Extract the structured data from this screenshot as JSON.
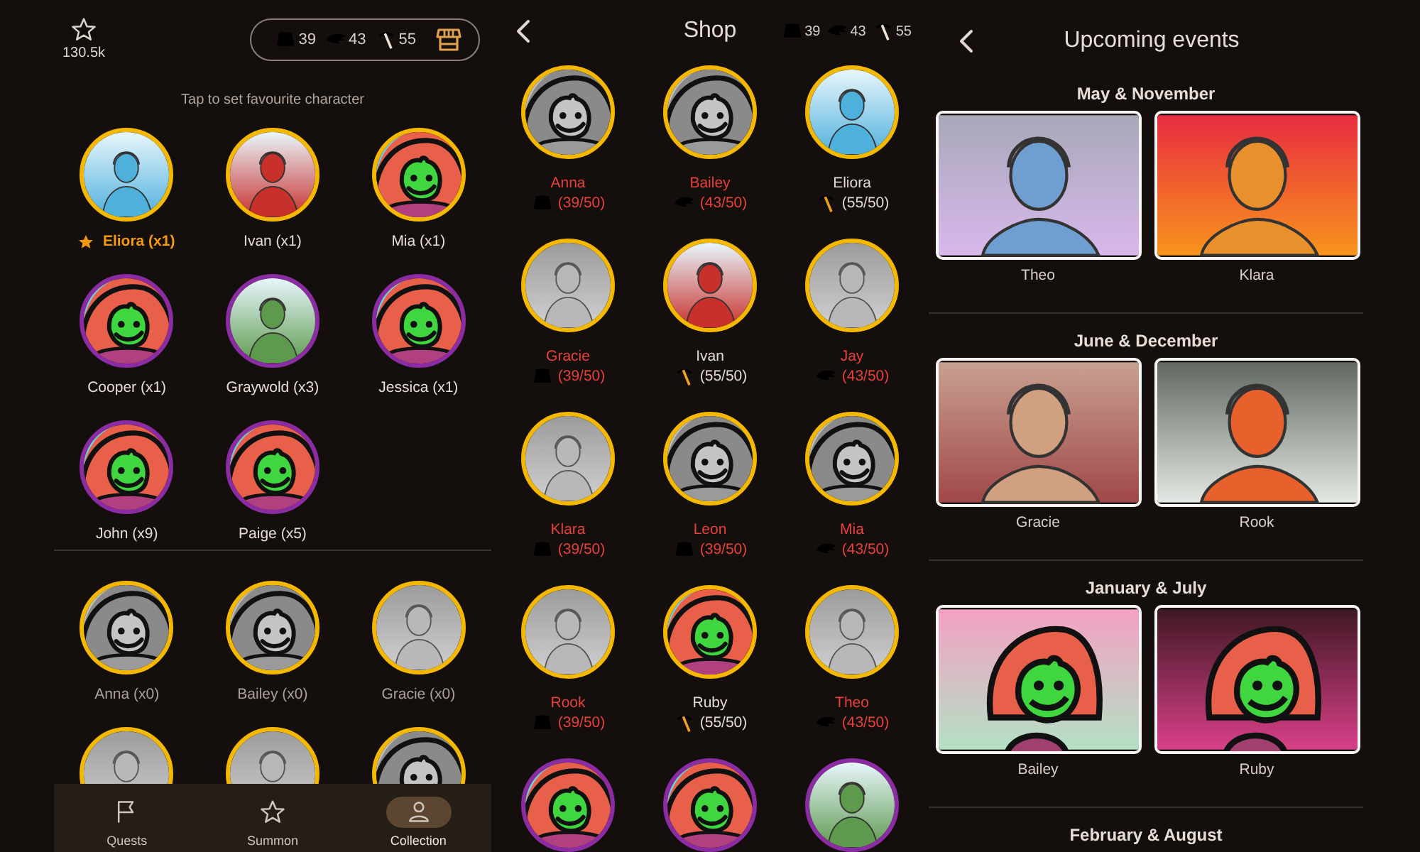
{
  "collection": {
    "stars": "130.5k",
    "currencies": [
      {
        "kind": "ticket",
        "amount": "39"
      },
      {
        "kind": "wing",
        "amount": "43"
      },
      {
        "kind": "pickaxe",
        "amount": "55"
      }
    ],
    "hint": "Tap to set favourite character",
    "owned": [
      {
        "label": "Eliora (x1)",
        "favourite": true,
        "color": "#f5b800",
        "avatar": {
          "kind": "portrait",
          "color": "#4fb0dc",
          "locked": false
        }
      },
      {
        "label": "Ivan (x1)",
        "favourite": false,
        "color": "#f5b800",
        "avatar": {
          "kind": "portrait",
          "color": "#c8302c",
          "locked": false
        }
      },
      {
        "label": "Mia (x1)",
        "favourite": false,
        "color": "#f5b800",
        "avatar": {
          "kind": "blob",
          "color": "#e8604a",
          "locked": false
        }
      },
      {
        "label": "Cooper (x1)",
        "favourite": false,
        "color": "#8c2ca4",
        "avatar": {
          "kind": "blob",
          "color": "#e8604a",
          "locked": false
        }
      },
      {
        "label": "Graywold (x3)",
        "favourite": false,
        "color": "#8c2ca4",
        "avatar": {
          "kind": "portrait",
          "color": "#5e9a4e",
          "locked": false
        }
      },
      {
        "label": "Jessica (x1)",
        "favourite": false,
        "color": "#8c2ca4",
        "avatar": {
          "kind": "blob",
          "color": "#e8604a",
          "locked": false
        }
      },
      {
        "label": "John (x9)",
        "favourite": false,
        "color": "#8c2ca4",
        "avatar": {
          "kind": "blob",
          "color": "#e8604a",
          "locked": false
        }
      },
      {
        "label": "Paige (x5)",
        "favourite": false,
        "color": "#8c2ca4",
        "avatar": {
          "kind": "blob",
          "color": "#e8604a",
          "locked": false
        }
      }
    ],
    "not_owned": [
      {
        "label": "Anna (x0)",
        "color": "#f5b800",
        "avatar": {
          "kind": "blob",
          "locked": true
        }
      },
      {
        "label": "Bailey (x0)",
        "color": "#f5b800",
        "avatar": {
          "kind": "blob",
          "locked": true
        }
      },
      {
        "label": "Gracie (x0)",
        "color": "#f5b800",
        "avatar": {
          "kind": "portrait",
          "locked": true
        }
      },
      {
        "color": "#f5b800",
        "avatar": {
          "kind": "portrait",
          "locked": true
        }
      },
      {
        "color": "#f5b800",
        "avatar": {
          "kind": "portrait",
          "locked": true
        }
      },
      {
        "color": "#f5b800",
        "avatar": {
          "kind": "blob",
          "locked": true
        }
      }
    ],
    "nav": [
      {
        "label": "Quests",
        "kind": "flag",
        "selected": false
      },
      {
        "label": "Summon",
        "kind": "star",
        "selected": false
      },
      {
        "label": "Collection",
        "kind": "person",
        "selected": true
      }
    ]
  },
  "shop": {
    "title": "Shop",
    "currencies": [
      {
        "kind": "ticket",
        "amount": "39"
      },
      {
        "kind": "wing",
        "amount": "43"
      },
      {
        "kind": "pickaxe",
        "amount": "55"
      }
    ],
    "items": [
      {
        "name": "Anna",
        "currency": {
          "kind": "ticket"
        },
        "cost": "(39/50)",
        "affordable": false,
        "color": "#f5b800",
        "avatar": {
          "kind": "blob",
          "locked": true
        }
      },
      {
        "name": "Bailey",
        "currency": {
          "kind": "wing"
        },
        "cost": "(43/50)",
        "affordable": false,
        "color": "#f5b800",
        "avatar": {
          "kind": "blob",
          "locked": true
        }
      },
      {
        "name": "Eliora",
        "currency": {
          "kind": "pickaxe"
        },
        "cost": "(55/50)",
        "affordable": true,
        "color": "#f5b800",
        "avatar": {
          "kind": "portrait",
          "color": "#4fb0dc",
          "locked": false
        }
      },
      {
        "name": "Gracie",
        "currency": {
          "kind": "ticket"
        },
        "cost": "(39/50)",
        "affordable": false,
        "color": "#f5b800",
        "avatar": {
          "kind": "portrait",
          "locked": true
        }
      },
      {
        "name": "Ivan",
        "currency": {
          "kind": "pickaxe"
        },
        "cost": "(55/50)",
        "affordable": true,
        "color": "#f5b800",
        "avatar": {
          "kind": "portrait",
          "color": "#c8302c",
          "locked": false
        }
      },
      {
        "name": "Jay",
        "currency": {
          "kind": "wing"
        },
        "cost": "(43/50)",
        "affordable": false,
        "color": "#f5b800",
        "avatar": {
          "kind": "portrait",
          "locked": true
        }
      },
      {
        "name": "Klara",
        "currency": {
          "kind": "ticket"
        },
        "cost": "(39/50)",
        "affordable": false,
        "color": "#f5b800",
        "avatar": {
          "kind": "portrait",
          "locked": true
        }
      },
      {
        "name": "Leon",
        "currency": {
          "kind": "ticket"
        },
        "cost": "(39/50)",
        "affordable": false,
        "color": "#f5b800",
        "avatar": {
          "kind": "blob",
          "locked": true
        }
      },
      {
        "name": "Mia",
        "currency": {
          "kind": "wing"
        },
        "cost": "(43/50)",
        "affordable": false,
        "color": "#f5b800",
        "avatar": {
          "kind": "blob",
          "locked": true
        }
      },
      {
        "name": "Rook",
        "currency": {
          "kind": "ticket"
        },
        "cost": "(39/50)",
        "affordable": false,
        "color": "#f5b800",
        "avatar": {
          "kind": "portrait",
          "locked": true
        }
      },
      {
        "name": "Ruby",
        "currency": {
          "kind": "pickaxe"
        },
        "cost": "(55/50)",
        "affordable": true,
        "color": "#f5b800",
        "avatar": {
          "kind": "blob",
          "color": "#e8604a",
          "locked": false
        }
      },
      {
        "name": "Theo",
        "currency": {
          "kind": "wing"
        },
        "cost": "(43/50)",
        "affordable": false,
        "color": "#f5b800",
        "avatar": {
          "kind": "portrait",
          "locked": true
        }
      },
      {
        "color": "#8c2ca4",
        "avatar": {
          "kind": "blob",
          "color": "#e8604a",
          "locked": false
        }
      },
      {
        "color": "#8c2ca4",
        "avatar": {
          "kind": "blob",
          "color": "#e8604a",
          "locked": false
        }
      },
      {
        "color": "#8c2ca4",
        "avatar": {
          "kind": "portrait",
          "color": "#5e9a4e",
          "locked": false
        }
      }
    ]
  },
  "events": {
    "title": "Upcoming events",
    "sections": [
      {
        "title": "May & November",
        "characters": [
          {
            "name": "Theo",
            "kind": "portrait",
            "color": "#6f9ed0",
            "backdrop": [
              {
                "color": "#a8a8b8"
              },
              {
                "color": "#d8b8ec"
              }
            ]
          },
          {
            "name": "Klara",
            "kind": "portrait",
            "color": "#e8902c",
            "backdrop": [
              {
                "color": "#e82c40"
              },
              {
                "color": "#f8941c"
              }
            ]
          }
        ]
      },
      {
        "title": "June & December",
        "characters": [
          {
            "name": "Gracie",
            "kind": "portrait",
            "color": "#d0a080",
            "backdrop": [
              {
                "color": "#c8a090"
              },
              {
                "color": "#a04848"
              }
            ]
          },
          {
            "name": "Rook",
            "kind": "portrait",
            "color": "#e8602c",
            "backdrop": [
              {
                "color": "#606860"
              },
              {
                "color": "#e4e8e4"
              }
            ]
          }
        ]
      },
      {
        "title": "January & July",
        "characters": [
          {
            "name": "Bailey",
            "kind": "blob",
            "color": "#e8604a",
            "backdrop": [
              {
                "color": "#f4a0c4"
              },
              {
                "color": "#b4e0c4"
              }
            ]
          },
          {
            "name": "Ruby",
            "kind": "blob",
            "color": "#e8604a",
            "backdrop": [
              {
                "color": "#401824"
              },
              {
                "color": "#d84088"
              }
            ]
          }
        ]
      },
      {
        "title": "February & August"
      }
    ]
  }
}
